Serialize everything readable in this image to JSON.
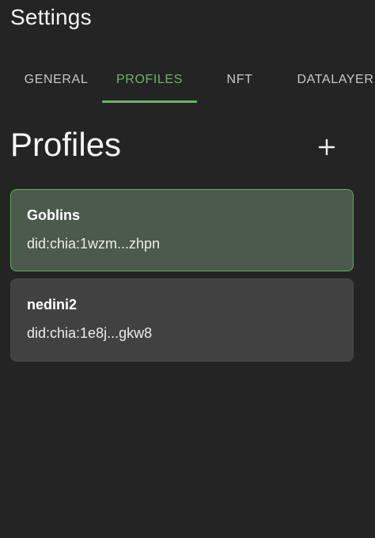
{
  "header": {
    "title": "Settings"
  },
  "tabs": [
    {
      "label": "GENERAL",
      "active": false
    },
    {
      "label": "PROFILES",
      "active": true
    },
    {
      "label": "NFT",
      "active": false
    },
    {
      "label": "DATALAYER",
      "active": false
    }
  ],
  "main": {
    "section_title": "Profiles",
    "add_icon": "plus-icon",
    "profiles": [
      {
        "name": "Goblins",
        "did": "did:chia:1wzm...zhpn",
        "selected": true
      },
      {
        "name": "nedini2",
        "did": "did:chia:1e8j...gkw8",
        "selected": false
      }
    ]
  },
  "colors": {
    "background": "#242424",
    "accent": "#6ab46a",
    "selected_card": "#4b5a4b",
    "card": "#414141"
  }
}
